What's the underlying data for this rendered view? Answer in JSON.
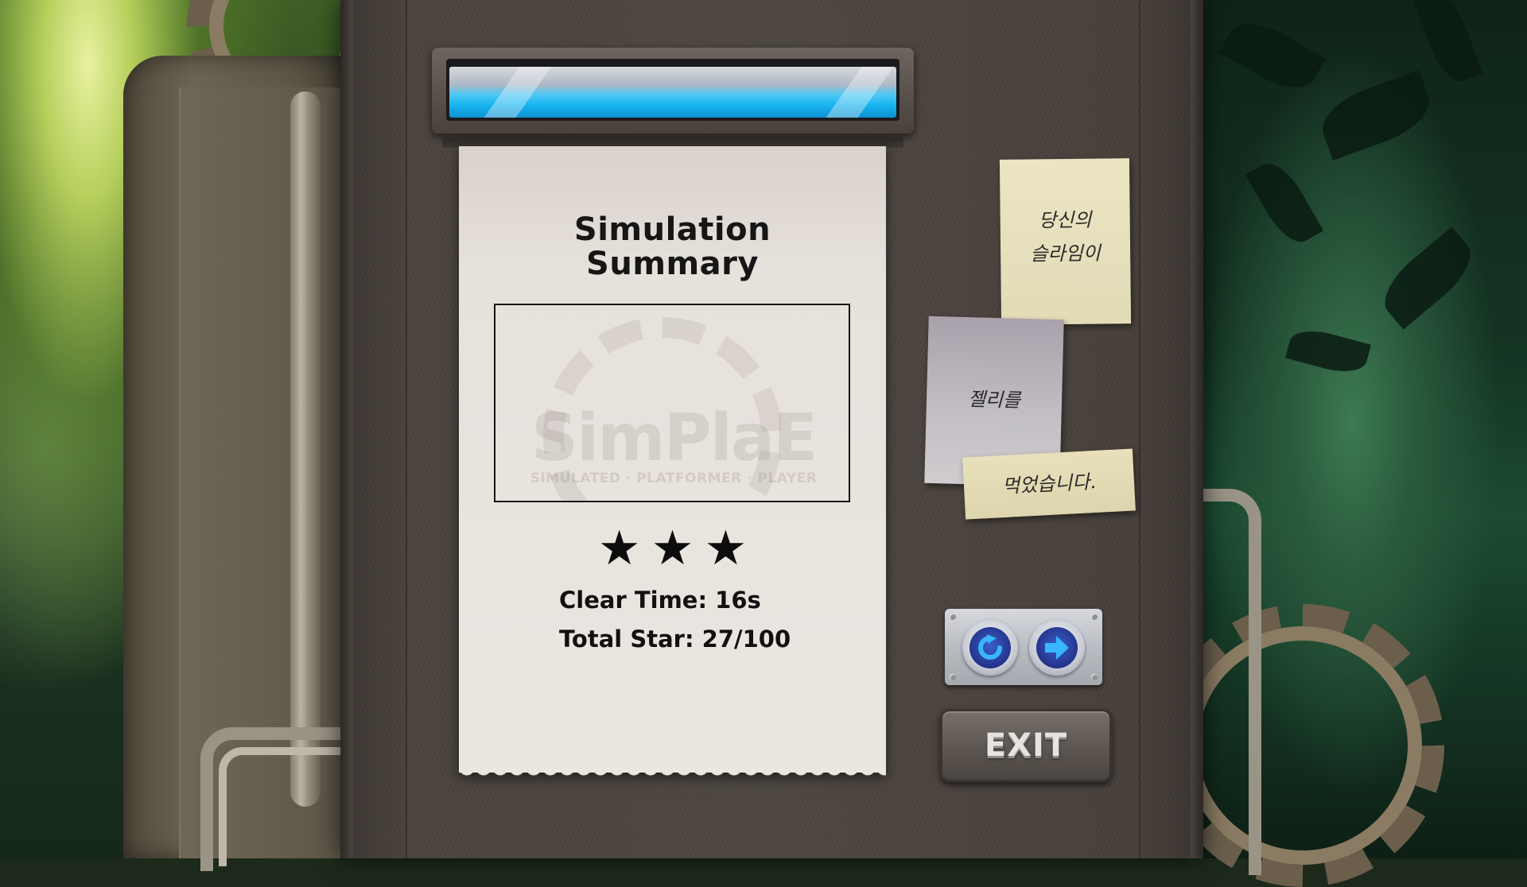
{
  "receipt": {
    "title_line1": "Simulation",
    "title_line2": "Summary",
    "watermark_title": "SimPlaE",
    "watermark_subtitle": "SIMULATED · PLATFORMER · PLAYER",
    "stars_earned": 3,
    "star_glyph": "★",
    "clear_time": "Clear Time: 16s",
    "total_star": "Total Star: 27/100"
  },
  "notes": {
    "note1_line1": "당신의",
    "note1_line2": "슬라임이",
    "note2_text": "젤리를",
    "note3_text": "먹었습니다."
  },
  "controls": {
    "retry_icon": "retry-icon",
    "next_icon": "next-arrow-icon",
    "exit_label": "EXIT"
  },
  "colors": {
    "slot_light": "#18b5f0",
    "button_core": "#2a3fa8",
    "arrow": "#38b6ff"
  }
}
